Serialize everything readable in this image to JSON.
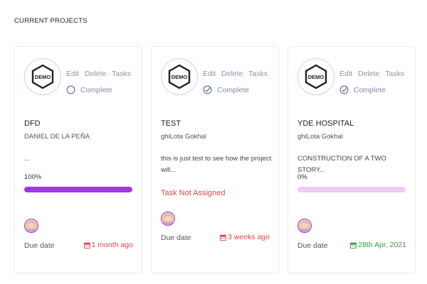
{
  "section_title": "CURRENT PROJECTS",
  "colors": {
    "accent": "#a335e3",
    "progress_track": "#eecbf3",
    "overdue": "#e0454d",
    "upcoming": "#3a9a3a",
    "muted": "#8a93a8"
  },
  "projects": [
    {
      "logo_text": "DEMO",
      "actions": {
        "edit": "Edit",
        "delete": "Delete",
        "tasks": "Tasks"
      },
      "status": {
        "label": "Complete",
        "icon": "circle-icon"
      },
      "name": "DFD",
      "owner": "DANIEL DE LA PEÑA",
      "description": "...",
      "progress": {
        "label": "100%",
        "value": 100
      },
      "due_label": "Due date",
      "due_value": "1 month ago"
    },
    {
      "logo_text": "DEMO",
      "actions": {
        "edit": "Edit",
        "delete": "Delete",
        "tasks": "Tasks"
      },
      "status": {
        "label": "Complete",
        "icon": "check-circle-icon"
      },
      "name": "TEST",
      "owner": "ghiLota Gokhal",
      "description": "this is just test to see how the project will...",
      "notice": "Task Not Assigned",
      "due_label": "Due date",
      "due_value": "3 weeks ago"
    },
    {
      "logo_text": "DEMO",
      "actions": {
        "edit": "Edit",
        "delete": "Delete",
        "tasks": "Tasks"
      },
      "status": {
        "label": "Complete",
        "icon": "check-circle-icon"
      },
      "name": "YDE HOSPITAL",
      "owner": "ghiLota Gokhal",
      "description": "CONSTRUCTION OF A TWO STORY...",
      "progress": {
        "label": "0%",
        "value": 0
      },
      "due_label": "Due date",
      "due_value": "28th Apr, 2021"
    }
  ]
}
